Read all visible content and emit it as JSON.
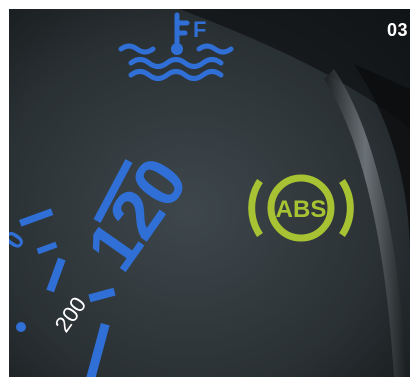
{
  "page_number": "03",
  "gauge": {
    "fuel_marker": "F",
    "speed_major": "120",
    "speed_minor": "200",
    "speed_cut": "0"
  },
  "warning_light": {
    "label": "ABS",
    "color": "#a7c232"
  },
  "colors": {
    "gauge_blue": "#2f6fd6",
    "dial_dark": "#2e363a"
  }
}
